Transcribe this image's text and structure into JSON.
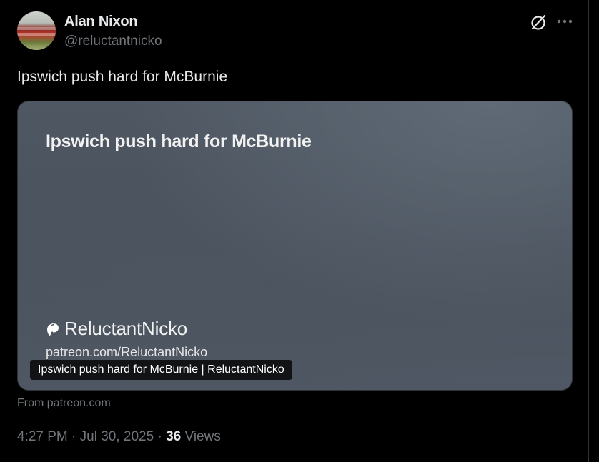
{
  "author": {
    "display_name": "Alan Nixon",
    "handle": "@reluctantnicko"
  },
  "tweet": {
    "text": "Ipswich push hard for McBurnie"
  },
  "card": {
    "headline": "Ipswich push hard for McBurnie",
    "brand_name": "ReluctantNicko",
    "url": "patreon.com/ReluctantNicko",
    "caption": "Ipswich push hard for McBurnie | ReluctantNicko",
    "source": "From patreon.com"
  },
  "meta": {
    "time": "4:27 PM",
    "separator": " · ",
    "date": "Jul 30, 2025",
    "views_count": "36",
    "views_label": " Views"
  },
  "icons": {
    "grok": "grok-slash-circle-icon",
    "more": "more-horizontal-icon",
    "patreon": "patreon-logo-icon"
  },
  "colors": {
    "background": "#000000",
    "primary_text": "#e7e9ea",
    "secondary_text": "#71767b",
    "card_background": "#4e5762"
  }
}
